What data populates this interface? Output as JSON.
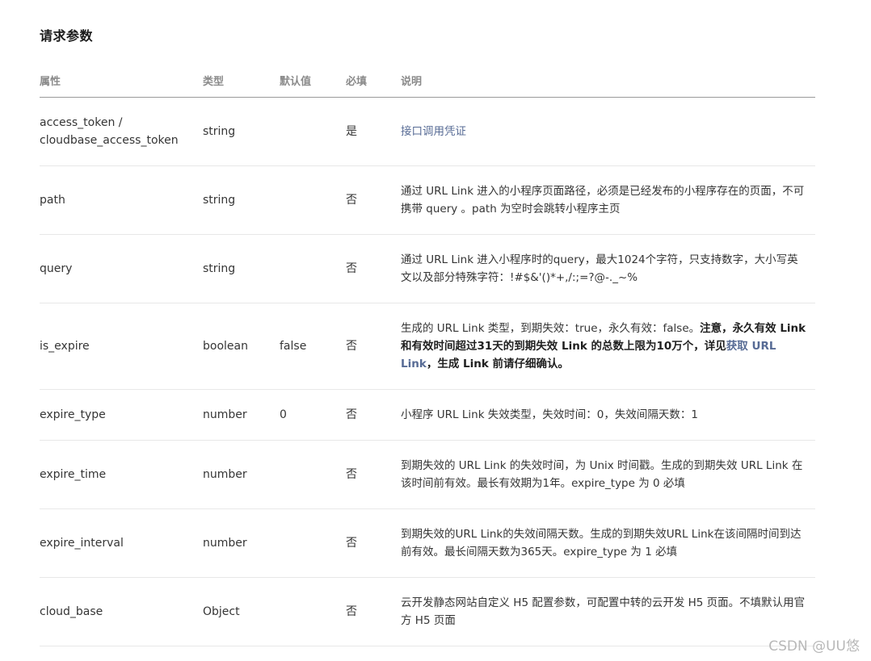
{
  "title": "请求参数",
  "headers": [
    "属性",
    "类型",
    "默认值",
    "必填",
    "说明"
  ],
  "rows": [
    {
      "name": "access_token /\ncloudbase_access_token",
      "type": "string",
      "default": "",
      "required": "是",
      "desc": [
        {
          "t": "接口调用凭证",
          "s": "link"
        }
      ]
    },
    {
      "name": "path",
      "type": "string",
      "default": "",
      "required": "否",
      "desc": [
        {
          "t": "通过 URL Link 进入的小程序页面路径，必须是已经发布的小程序存在的页面，不可携带 query 。path 为空时会跳转小程序主页",
          "s": "plain"
        }
      ]
    },
    {
      "name": "query",
      "type": "string",
      "default": "",
      "required": "否",
      "desc": [
        {
          "t": "通过 URL Link 进入小程序时的query，最大1024个字符，只支持数字，大小写英文以及部分特殊字符：!#$&'()*+,/:;=?@-._~%",
          "s": "plain"
        }
      ]
    },
    {
      "name": "is_expire",
      "type": "boolean",
      "default": "false",
      "required": "否",
      "desc": [
        {
          "t": "生成的 URL Link 类型，到期失效：true，永久有效：false。",
          "s": "plain"
        },
        {
          "t": "注意，永久有效 Link 和有效时间超过31天的到期失效 Link 的总数上限为10万个，详见",
          "s": "strong"
        },
        {
          "t": "获取 URL Link",
          "s": "strong-link"
        },
        {
          "t": "，生成 Link 前请仔细确认。",
          "s": "strong"
        }
      ]
    },
    {
      "name": "expire_type",
      "type": "number",
      "default": "0",
      "required": "否",
      "desc": [
        {
          "t": "小程序 URL Link 失效类型，失效时间：0，失效间隔天数：1",
          "s": "plain"
        }
      ]
    },
    {
      "name": "expire_time",
      "type": "number",
      "default": "",
      "required": "否",
      "desc": [
        {
          "t": "到期失效的 URL Link 的失效时间，为 Unix 时间戳。生成的到期失效 URL Link 在该时间前有效。最长有效期为1年。expire_type 为 0 必填",
          "s": "plain"
        }
      ]
    },
    {
      "name": "expire_interval",
      "type": "number",
      "default": "",
      "required": "否",
      "desc": [
        {
          "t": "到期失效的URL Link的失效间隔天数。生成的到期失效URL Link在该间隔时间到达前有效。最长间隔天数为365天。expire_type 为 1 必填",
          "s": "plain"
        }
      ]
    },
    {
      "name": "cloud_base",
      "type": "Object",
      "default": "",
      "required": "否",
      "desc": [
        {
          "t": "云开发静态网站自定义 H5 配置参数，可配置中转的云开发 H5 页面。不填默认用官方 H5 页面",
          "s": "plain"
        }
      ]
    }
  ],
  "watermark": "CSDN @UU悠"
}
